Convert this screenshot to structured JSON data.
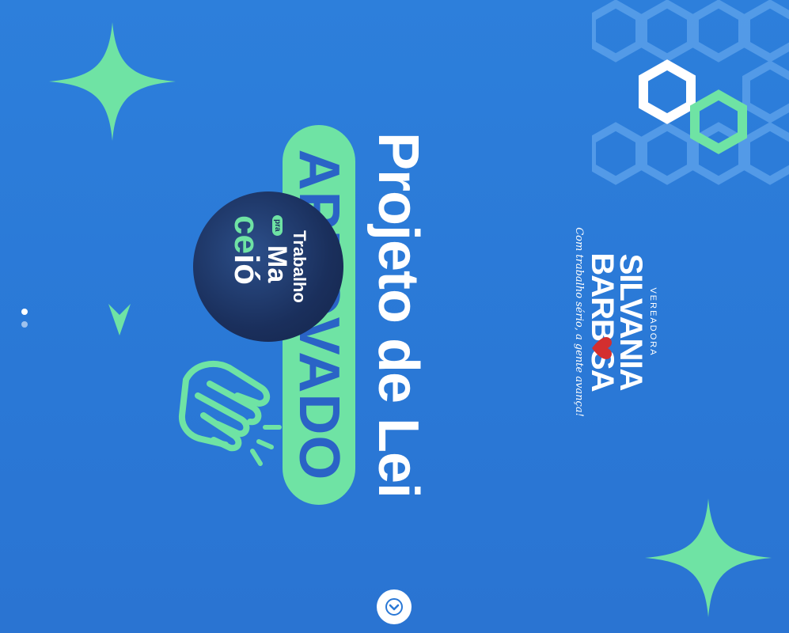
{
  "headline": {
    "title": "Projeto de Lei",
    "status": "APROVADO"
  },
  "brand": {
    "role": "VEREADORA",
    "line1": "SILVANIA",
    "line2": "BARB  SA",
    "slogan": "Com trabalho sério, a gente avança!"
  },
  "badge": {
    "line1": "Trabalho",
    "pra": "pra",
    "line2": "Ma",
    "line3_a": "ce",
    "line3_b": "ió"
  },
  "colors": {
    "background": "#2a78d6",
    "accent_green": "#6fe3a4",
    "text_blue": "#2a63c6",
    "heart_red": "#d32f2f"
  },
  "icons": [
    "sparkle-icon",
    "hexagon-pattern",
    "heart-icon",
    "handshake-icon",
    "chevron-down-icon",
    "arrow-down-icon"
  ],
  "pager": {
    "total": 2,
    "active": 1
  }
}
